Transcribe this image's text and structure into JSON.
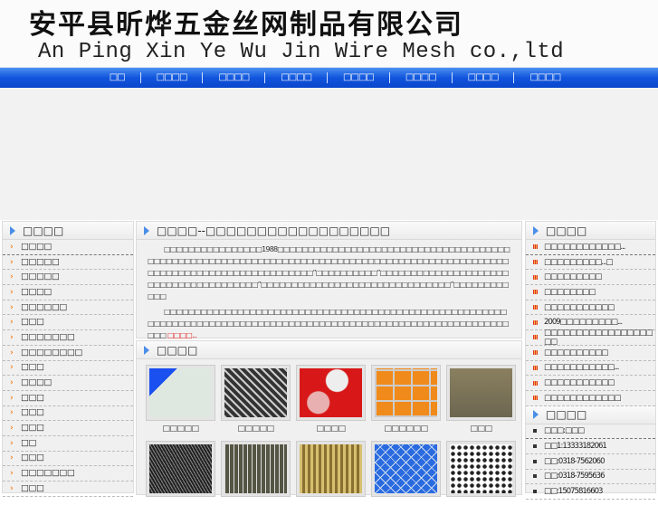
{
  "header": {
    "title_cn": "安平县昕烨五金丝网制品有限公司",
    "title_en": "An Ping Xin Ye Wu Jin Wire Mesh co.,ltd"
  },
  "nav": [
    "□□",
    "□□□□",
    "□□□□",
    "□□□□",
    "□□□□",
    "□□□□",
    "□□□□",
    "□□□□"
  ],
  "left": {
    "title": "□□□□",
    "items": [
      "□□□□",
      "□□□□□",
      "□□□□□",
      "□□□□",
      "□□□□□□",
      "□□□",
      "□□□□□□□",
      "□□□□□□□□",
      "□□□",
      "□□□□",
      "□□□",
      "□□□",
      "□□□",
      "□□",
      "□□□",
      "□□□□□□□",
      "□□□"
    ]
  },
  "about": {
    "title": "□□□□--□□□□□□□□□□□□□□□□□□",
    "p1": "□□□□□□□□□□□□□□□□1988□□□□□□□□□□□□□□□□□□□□□□□□□□□□□□□□□□□□□□□□□□□□□□□□□□□□□□□□□□□□□□□□□□□□□□□□□□□□□□□□□□□□□□□□□□□□□□□□□□□□□□□□□□□□□□□□□□□□□□□□□□□□”□□□□□□□□□□”□□□□□□□□□□□□□□□□□□□□□□□□□□□□□□□□□□□□□□□”□□□□□□□□□□□□□□□□□□□□□□□□□□□□□□□”□□□□□□□□□□□□",
    "p2": "□□□□□□□□□□□□□□□□□□□□□□□□□□□□□□□□□□□□□□□□□□□□□□□□□□□□□□□□□□□□□□□□□□□□□□□□□□□□□□□□□□□□□□□□□□□□□□□□□□□□□□□□□□□□□□□□□□□□□□ ",
    "more": "□□□□..."
  },
  "products": {
    "title": "□□□□",
    "items": [
      {
        "label": "□□□□□"
      },
      {
        "label": "□□□□□"
      },
      {
        "label": "□□□□"
      },
      {
        "label": "□□□□□□"
      },
      {
        "label": "□□□"
      },
      {
        "label": ""
      },
      {
        "label": ""
      },
      {
        "label": ""
      },
      {
        "label": ""
      },
      {
        "label": ""
      }
    ]
  },
  "news": {
    "title": "□□□□",
    "items": [
      "□□□□□□□□□□□□...",
      "□□□□□□□□□...□",
      "□□□□□□□□□",
      "□□□□□□□□",
      "□□□□□□□□□□□",
      "2009□□□□□□□□□...",
      "□□□□□□□□□□□□□□□□□□□",
      "□□□□□□□□□□",
      "□□□□□□□□□□□...",
      "□□□□□□□□□□□",
      "□□□□□□□□□□□□"
    ]
  },
  "contact": {
    "title": "□□□□",
    "items": [
      "□□□:□□□",
      "□□1:13333182061",
      "□□:0318-7562060",
      "□□:0318-7595636",
      "□□:15075816603"
    ]
  },
  "colors": {
    "nav": "#1155dd",
    "accent": "#4a8ee8",
    "more": "#e02020"
  }
}
